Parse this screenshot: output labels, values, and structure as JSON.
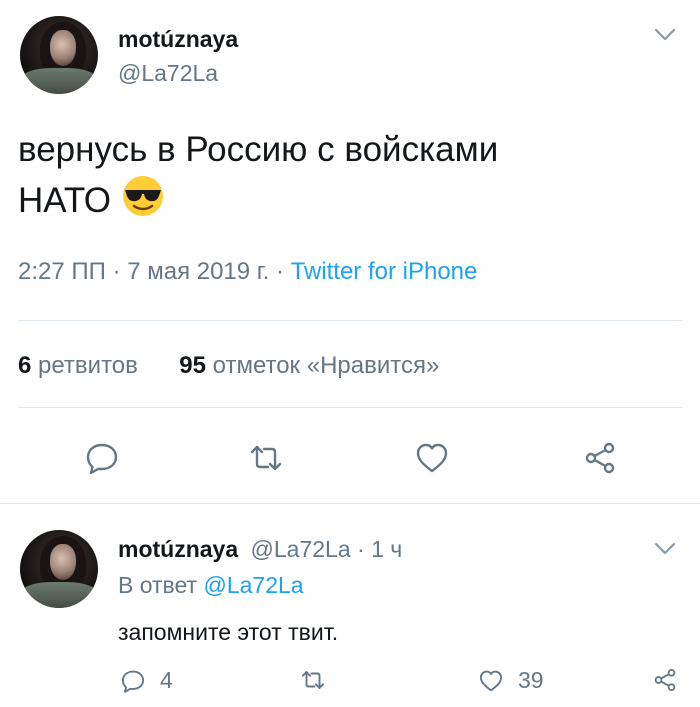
{
  "main_tweet": {
    "display_name": "motúznaya",
    "handle": "@La72La",
    "text_line1": "вернусь в Россию с войсками",
    "text_line2": "НАТО",
    "emoji": "smiling-face-with-sunglasses",
    "time": "2:27 ПП · 7 мая 2019 г. · ",
    "source": "Twitter for iPhone",
    "retweets_count": "6",
    "retweets_label": "ретвитов",
    "likes_count": "95",
    "likes_label": "отметок «Нравится»"
  },
  "reply": {
    "display_name": "motúznaya",
    "handle_time": "@La72La · 1 ч",
    "reply_prefix": "В ответ ",
    "reply_to_handle": "@La72La",
    "text": "запомните этот твит.",
    "reply_count": "4",
    "like_count": "39"
  },
  "colors": {
    "text": "#14171a",
    "secondary": "#657786",
    "link": "#1da1f2",
    "divider": "#e1e8ed"
  }
}
